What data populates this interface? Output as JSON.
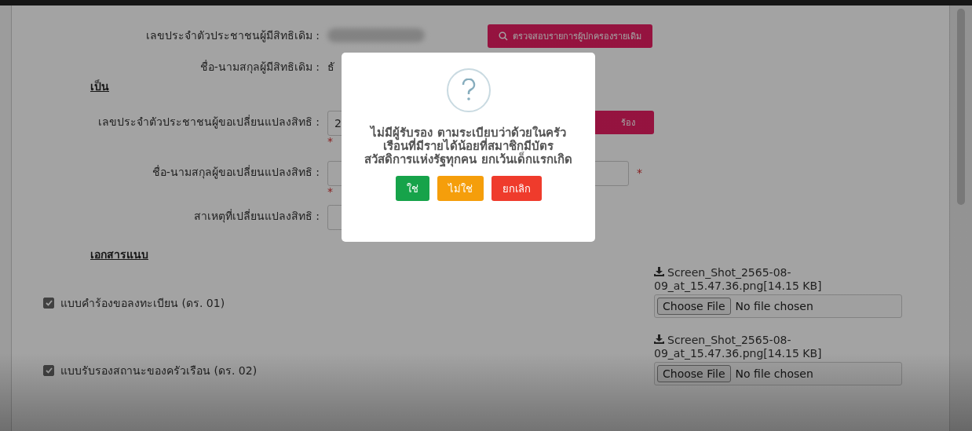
{
  "original_holder": {
    "id_label": "เลขประจำตัวประชาชนผู้มีสิทธิเดิม :",
    "check_button": "ตรวจสอบรายการผู้ปกครองรายเดิม",
    "name_label": "ชื่อ-นามสกุลผู้มีสิทธิเดิม :",
    "name_value": "ธั"
  },
  "section_title": "เป็น",
  "new_holder_fields": [
    {
      "label": "เลขประจำตัวประชาชนผู้ขอเปลี่ยนแปลงสิทธิ :",
      "value": "2",
      "marker": "*",
      "button": "ร้อง"
    },
    {
      "label": "ชื่อ-นามสกุลผู้ขอเปลี่ยนแปลงสิทธิ :",
      "marker": "*",
      "side_marker": "*"
    },
    {
      "label": "สาเหตุที่เปลี่ยนแปลงสิทธิ :"
    }
  ],
  "attachments_title": "เอกสารแนบ",
  "attachments": [
    {
      "label": "แบบคำร้องขอลงทะเบียน (ดร. 01)",
      "checked": true,
      "file_link": "Screen_Shot_2565-08-09_at_15.47.36.png[14.15 KB]",
      "choose_button": "Choose File",
      "file_status": "No file chosen"
    },
    {
      "label": "แบบรับรองสถานะของครัวเรือน (ดร. 02)",
      "checked": true,
      "file_link": "Screen_Shot_2565-08-09_at_15.47.36.png[14.15 KB]",
      "choose_button": "Choose File",
      "file_status": "No file chosen"
    }
  ],
  "dialog": {
    "message": "ไม่มีผู้รับรอง ตามระเบียบว่าด้วยในครัวเรือนที่มีรายได้น้อยที่สมาชิกมีบัตรสวัสดิการแห่งรัฐทุกคน ยกเว้นเด็กแรกเกิด",
    "buttons": [
      {
        "label": "ใช่",
        "kind": "confirm"
      },
      {
        "label": "ไม่ใช่",
        "kind": "deny"
      },
      {
        "label": "ยกเลิก",
        "kind": "cancel"
      }
    ]
  }
}
